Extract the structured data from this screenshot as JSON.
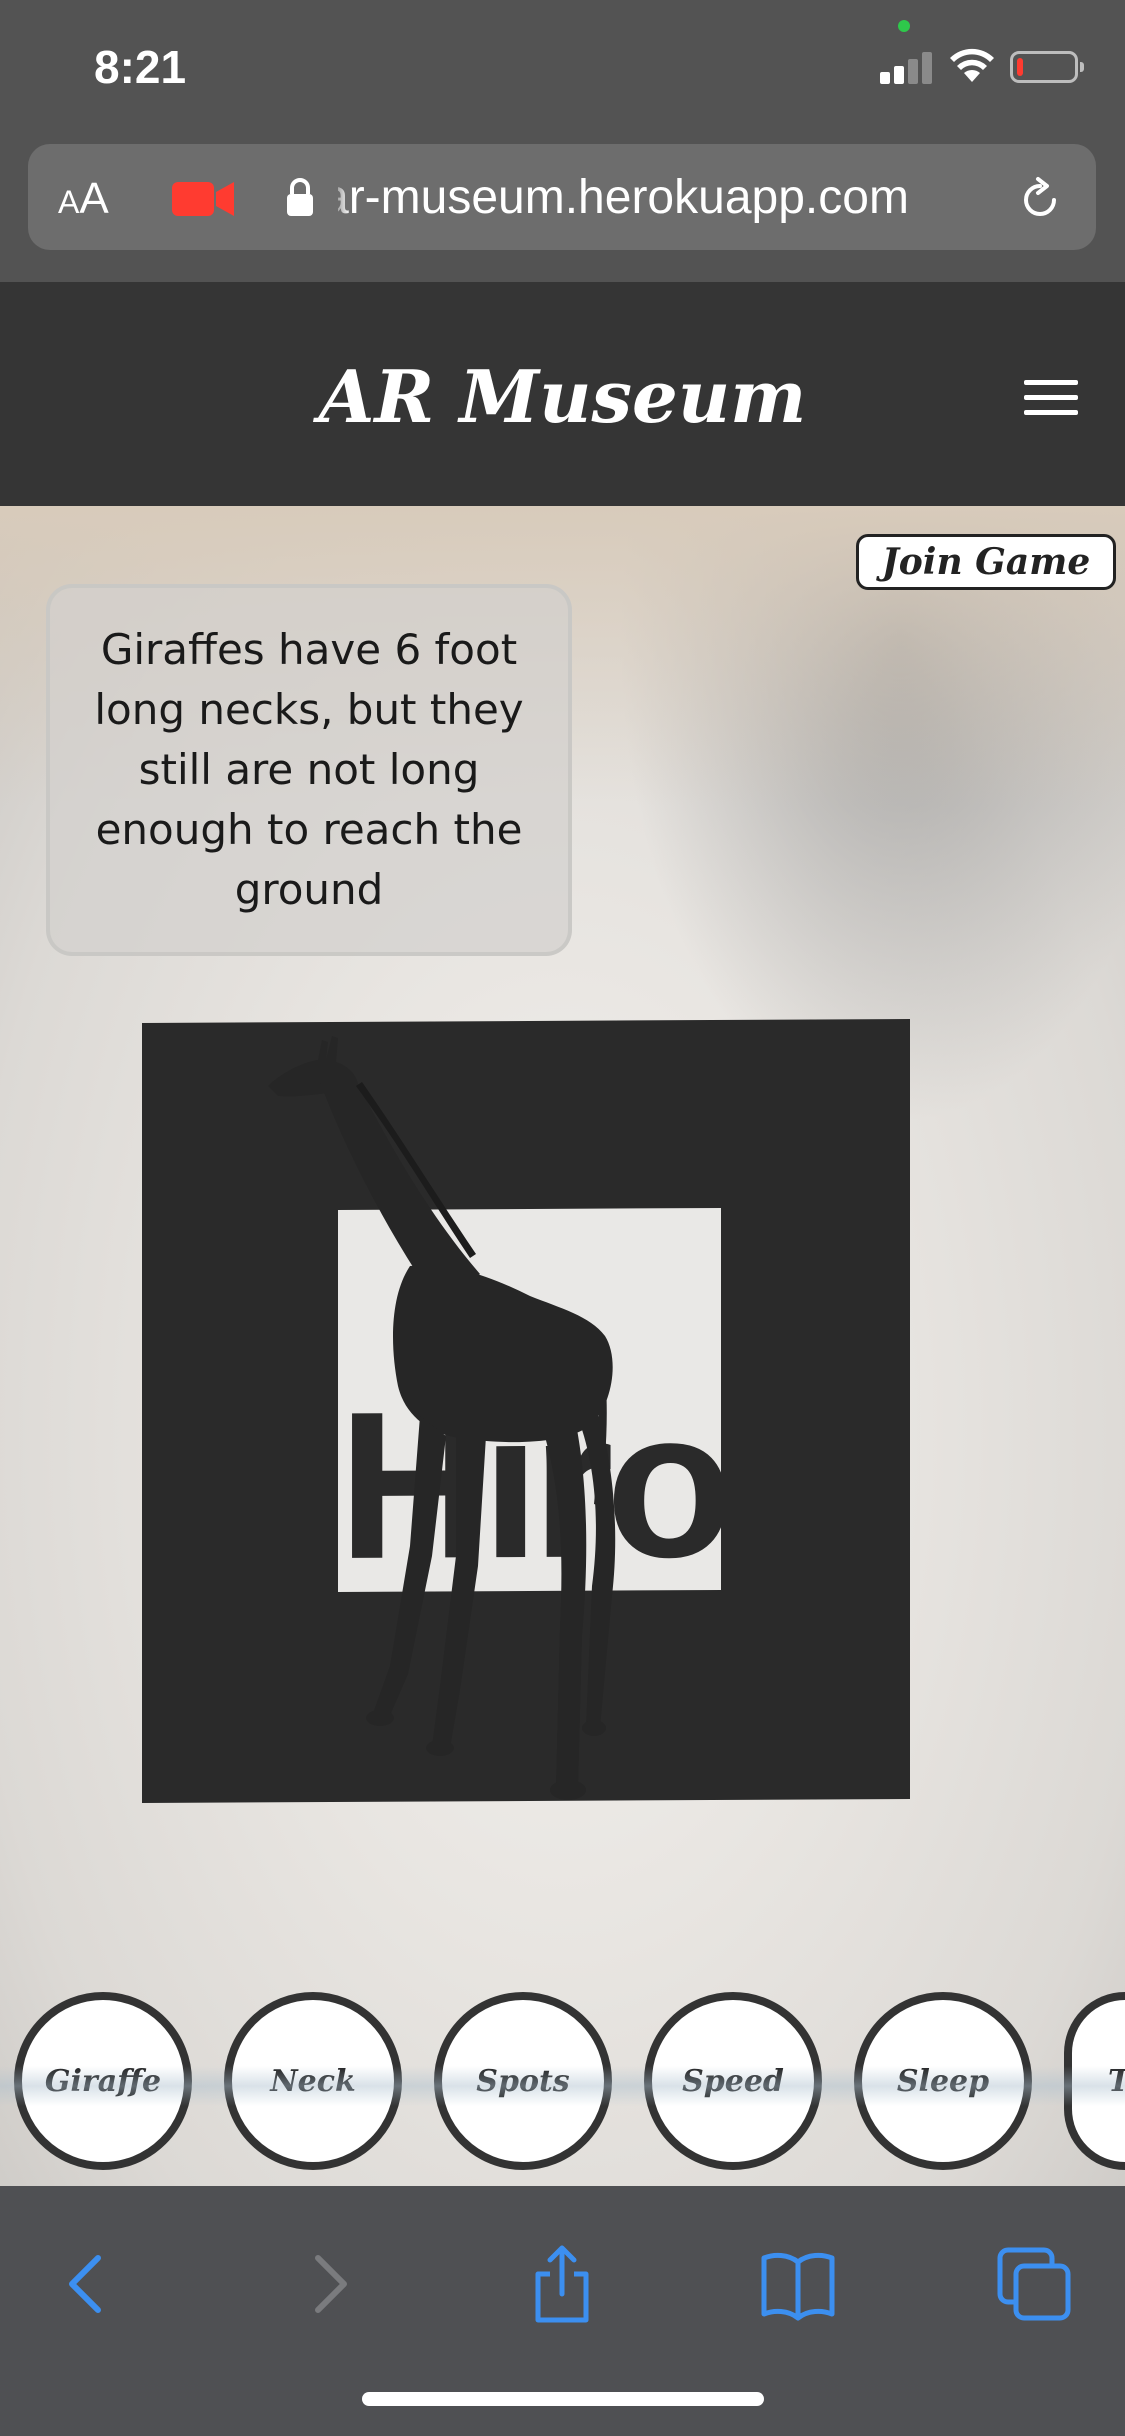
{
  "status_bar": {
    "time": "8:21",
    "camera_indicator_color": "#2ec84b",
    "battery_color": "#ff3b30"
  },
  "browser": {
    "aa_small": "A",
    "aa_large": "A",
    "url": "ar-museum.herokuapp.com",
    "recording_icon_color": "#ff3b30",
    "icons": [
      "text-size-icon",
      "camera-recording-icon",
      "lock-icon",
      "reload-icon"
    ]
  },
  "site": {
    "title": "AR Museum",
    "menu_icon": "hamburger-menu-icon"
  },
  "ar": {
    "join_game_label": "Join Game",
    "fact_text": "Giraffes have 6 foot long necks, but they still are not long enough to reach the ground",
    "marker_text": "Hiro",
    "fact_buttons": [
      "Giraffe",
      "Neck",
      "Spots",
      "Speed",
      "Sleep",
      "T"
    ]
  },
  "toolbar": {
    "accent_color": "#3c8ff0",
    "icons": [
      "back-icon",
      "forward-icon",
      "share-icon",
      "bookmarks-icon",
      "tabs-icon"
    ]
  }
}
